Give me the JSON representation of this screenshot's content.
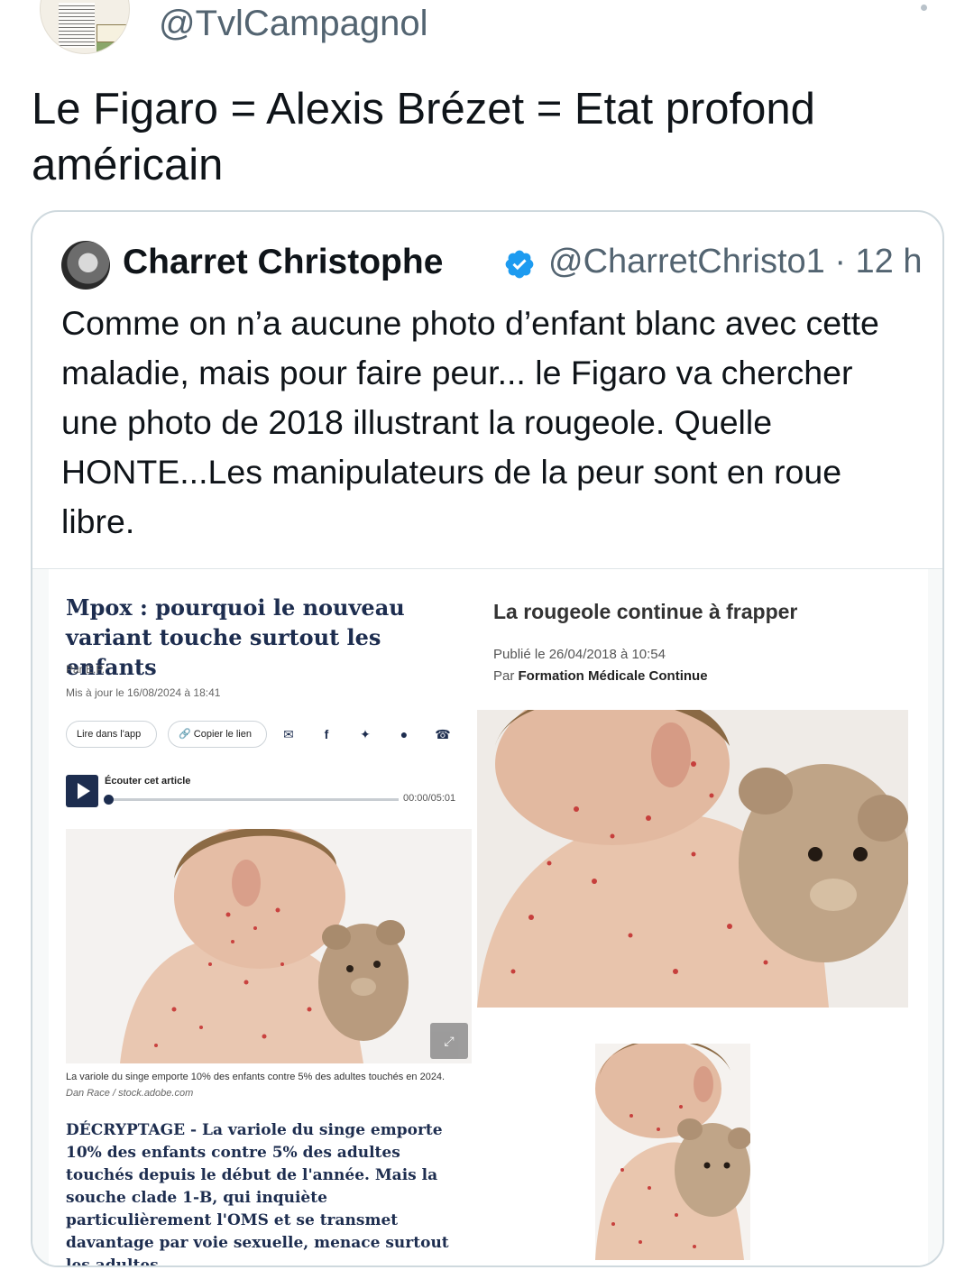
{
  "tweet": {
    "handle": "@TvlCampagnol",
    "text": "Le Figaro = Alexis Brézet = Etat profond américain"
  },
  "quote": {
    "name": "Charret Christophe",
    "handle_time": "@CharretChristo1 · 12 h",
    "text": "Comme on n’a aucune photo d’enfant blanc avec cette maladie, mais pour faire peur... le Figaro va chercher une photo de 2018 illustrant la rougeole. Quelle HONTE...Les manipulateurs de la peur sont en roue libre."
  },
  "left_article": {
    "title": "Mpox : pourquoi le nouveau variant touche surtout les enfants",
    "byline": "Par E.P.",
    "updated": "Mis à jour le 16/08/2024 à 18:41",
    "app_button": "Lire dans l'app",
    "copy_button": "Copier le lien",
    "listen_label": "Écouter cet article",
    "timecode": "00:00/05:01",
    "caption": "La variole du singe emporte 10% des enfants contre 5% des adultes touchés en 2024.",
    "credit": "Dan Race / stock.adobe.com",
    "lead": "DÉCRYPTAGE - La variole du singe emporte 10% des enfants contre 5% des adultes touchés depuis le début de l'année. Mais la souche clade 1-B, qui inquiète particulièrement l'OMS et se transmet davantage par voie sexuelle, menace surtout les adultes."
  },
  "right_article": {
    "title": "La rougeole continue à frapper",
    "published": "Publié le 26/04/2018 à 10:54",
    "author_prefix": "Par ",
    "author": "Formation Médicale Continue"
  },
  "icons": {
    "verified": "verified-badge-icon",
    "share": [
      "mail-icon",
      "facebook-icon",
      "twitter-icon",
      "messenger-icon",
      "whatsapp-icon"
    ],
    "accent": "#1d9bf0",
    "figaro_navy": "#1d2d4f"
  }
}
